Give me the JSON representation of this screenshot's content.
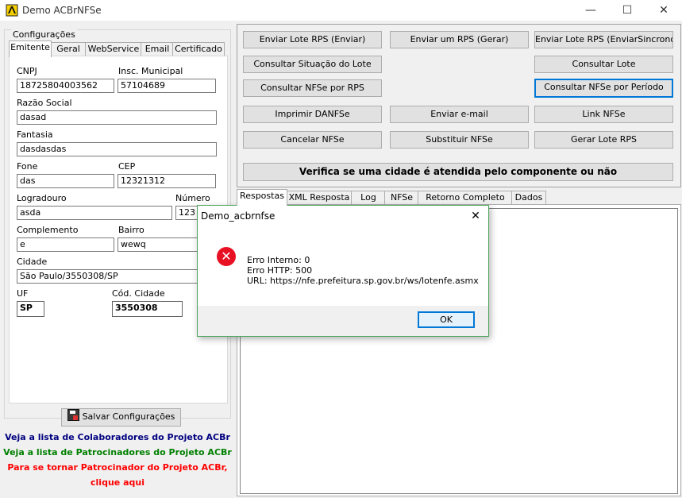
{
  "window": {
    "title": "Demo ACBrNFSe",
    "minimize": "—",
    "maximize": "☐",
    "close": "✕"
  },
  "config": {
    "legend": "Configurações",
    "tabs": [
      "Emitente",
      "Geral",
      "WebService",
      "Email",
      "Certificado"
    ],
    "fields": {
      "cnpj_label": "CNPJ",
      "cnpj": "18725804003562",
      "im_label": "Insc. Municipal",
      "im": "57104689",
      "razao_label": "Razão Social",
      "razao": "dasad",
      "fantasia_label": "Fantasia",
      "fantasia": "dasdasdas",
      "fone_label": "Fone",
      "fone": "das",
      "cep_label": "CEP",
      "cep": "12321312",
      "logradouro_label": "Logradouro",
      "logradouro": "asda",
      "numero_label": "Número",
      "numero": "123",
      "complemento_label": "Complemento",
      "complemento": "e",
      "bairro_label": "Bairro",
      "bairro": "wewq",
      "cidade_label": "Cidade",
      "cidade": "São Paulo/3550308/SP",
      "uf_label": "UF",
      "uf": "SP",
      "codcidade_label": "Cód. Cidade",
      "codcidade": "3550308"
    },
    "save_button": "Salvar Configurações"
  },
  "links": {
    "colaboradores": "Veja a lista de Colaboradores do Projeto ACBr",
    "patrocinadores": "Veja a lista de Patrocinadores do Projeto ACBr",
    "tornar1": "Para se tornar Patrocinador do Projeto ACBr,",
    "tornar2": "clique aqui",
    "colors": {
      "colaboradores": "#000080",
      "patrocinadores": "#008000",
      "tornar": "#ff0000"
    }
  },
  "actions": {
    "enviar_lote": "Enviar Lote RPS (Enviar)",
    "enviar_um": "Enviar um RPS (Gerar)",
    "enviar_sinc": "Enviar Lote RPS (EnviarSincrono)",
    "consultar_situacao": "Consultar Situação do Lote",
    "consultar_lote": "Consultar Lote",
    "consultar_rps": "Consultar NFSe por RPS",
    "consultar_periodo": "Consultar NFSe por Período",
    "imprimir": "Imprimir DANFSe",
    "enviar_email": "Enviar e-mail",
    "link_nfse": "Link NFSe",
    "cancelar": "Cancelar NFSe",
    "substituir": "Substituir NFSe",
    "gerar_lote": "Gerar Lote RPS",
    "verifica": "Verifica se uma cidade é atendida pelo componente ou não"
  },
  "response_tabs": [
    "Respostas",
    "XML Resposta",
    "Log",
    "NFSe",
    "Retorno Completo WS",
    "Dados"
  ],
  "dialog": {
    "title": "Demo_acbrnfse",
    "close": "✕",
    "icon": "error-icon",
    "line1": "Erro Interno: 0",
    "line2": "Erro HTTP: 500",
    "line3": "URL: https://nfe.prefeitura.sp.gov.br/ws/lotenfe.asmx",
    "ok": "OK"
  }
}
